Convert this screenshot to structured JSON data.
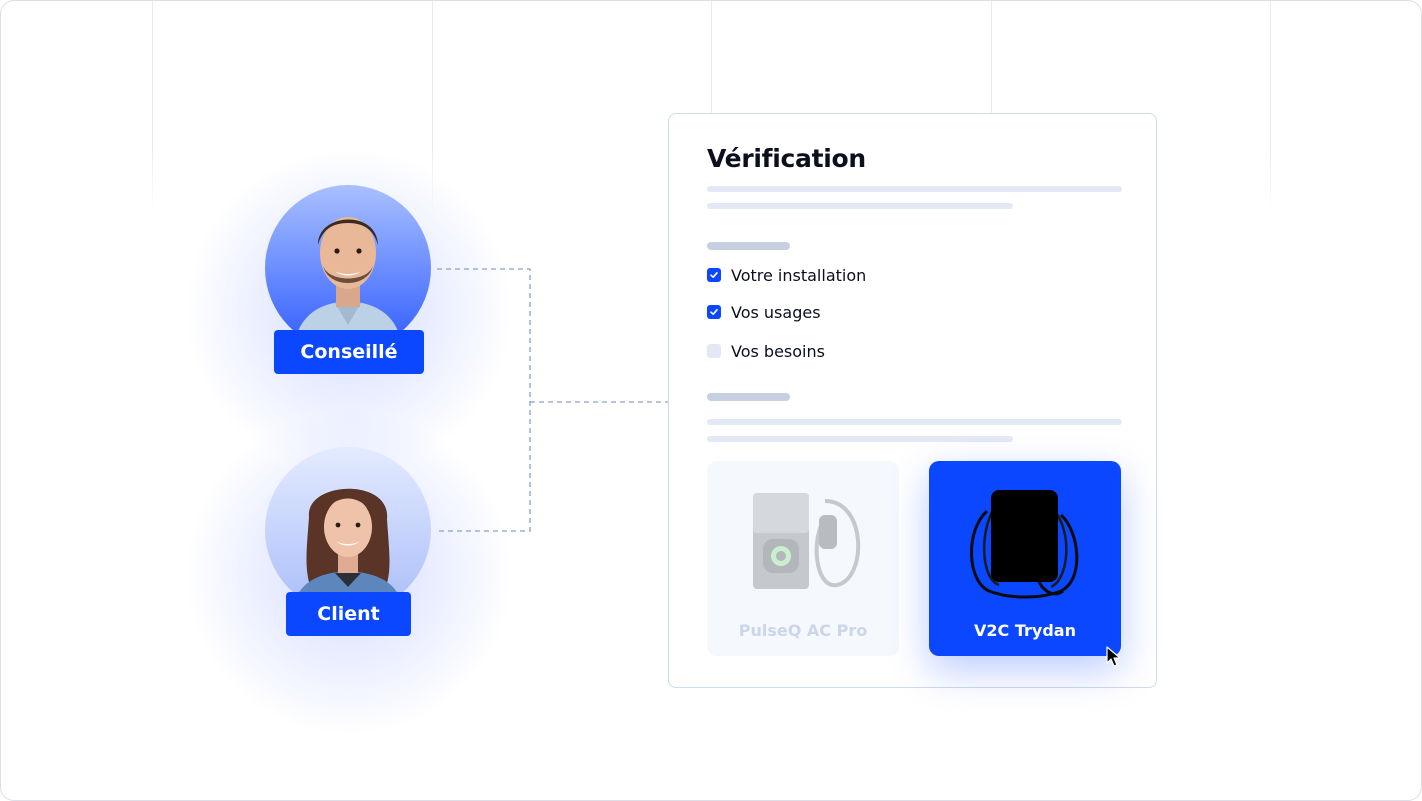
{
  "people": {
    "advisor": {
      "label": "Conseillé"
    },
    "client": {
      "label": "Client"
    }
  },
  "verification": {
    "title": "Vérification",
    "checklist": [
      {
        "label": "Votre installation",
        "checked": true
      },
      {
        "label": "Vos usages",
        "checked": true
      },
      {
        "label": "Vos besoins",
        "checked": false
      }
    ],
    "products": [
      {
        "name": "PulseQ  AC Pro",
        "selected": false
      },
      {
        "name": "V2C Trydan",
        "selected": true
      }
    ]
  },
  "colors": {
    "accent": "#0a47ff",
    "skeleton": "#e3e9f4",
    "connector": "#8aa2c4"
  }
}
